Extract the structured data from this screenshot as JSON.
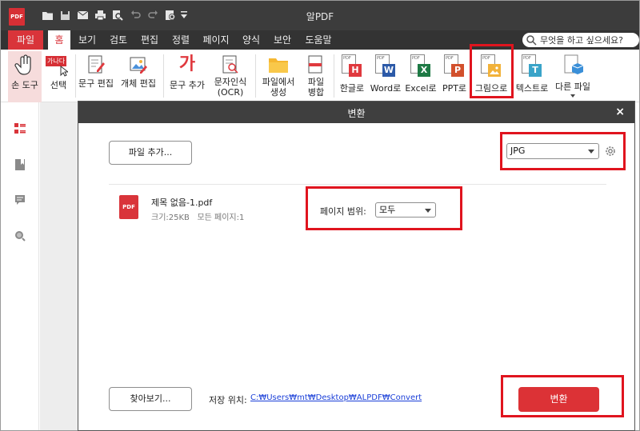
{
  "app": {
    "logo_text": "PDF",
    "title": "알PDF"
  },
  "quick_access": [
    "folder-icon",
    "save-icon",
    "mail-icon",
    "print-icon",
    "zoom-icon",
    "undo-icon",
    "redo-icon",
    "settings-icon",
    "dropdown-icon"
  ],
  "menu": {
    "items": [
      "파일",
      "홈",
      "보기",
      "검토",
      "편집",
      "정렬",
      "페이지",
      "양식",
      "보안",
      "도움말"
    ],
    "active": "홈",
    "search_placeholder": "무엇을 하고 싶으세요?"
  },
  "ribbon": {
    "hand_tool": "손 도구",
    "select": "선택",
    "select_badge": "가나다",
    "edit_text": "문구 편집",
    "edit_object": "개체 편집",
    "add_text": "문구 추가",
    "add_text_glyph": "가",
    "ocr_line1": "문자인식",
    "ocr_line2": "(OCR)",
    "create_from_file_line1": "파일에서",
    "create_from_file_line2": "생성",
    "merge_line1": "파일",
    "merge_line2": "병합",
    "to_hwp": "한글로",
    "to_word": "Word로",
    "to_excel": "Excel로",
    "to_ppt": "PPT로",
    "to_image": "그림으로",
    "to_text": "텍스트로",
    "other_file": "다른 파일",
    "icon_letters": {
      "hwp": "H",
      "word": "W",
      "excel": "X",
      "ppt": "P",
      "text": "T",
      "pdf": "PDF"
    }
  },
  "dialog": {
    "title": "변환",
    "close": "×",
    "add_file": "파일 추가...",
    "format_value": "JPG",
    "file": {
      "name": "제목 없음-1.pdf",
      "meta": "크기:25KB   모든 페이지:1",
      "icon_text": "PDF"
    },
    "page_range_label": "페이지 범위:",
    "page_range_value": "모두",
    "browse": "찾아보기...",
    "save_location_label": "저장 위치:",
    "save_path": "C:₩Users₩mt₩Desktop₩ALPDF₩Convert",
    "convert_button": "변환"
  },
  "colors": {
    "accent": "#d9343a",
    "highlight_box": "#e0141e",
    "link": "#1a3fd8"
  }
}
